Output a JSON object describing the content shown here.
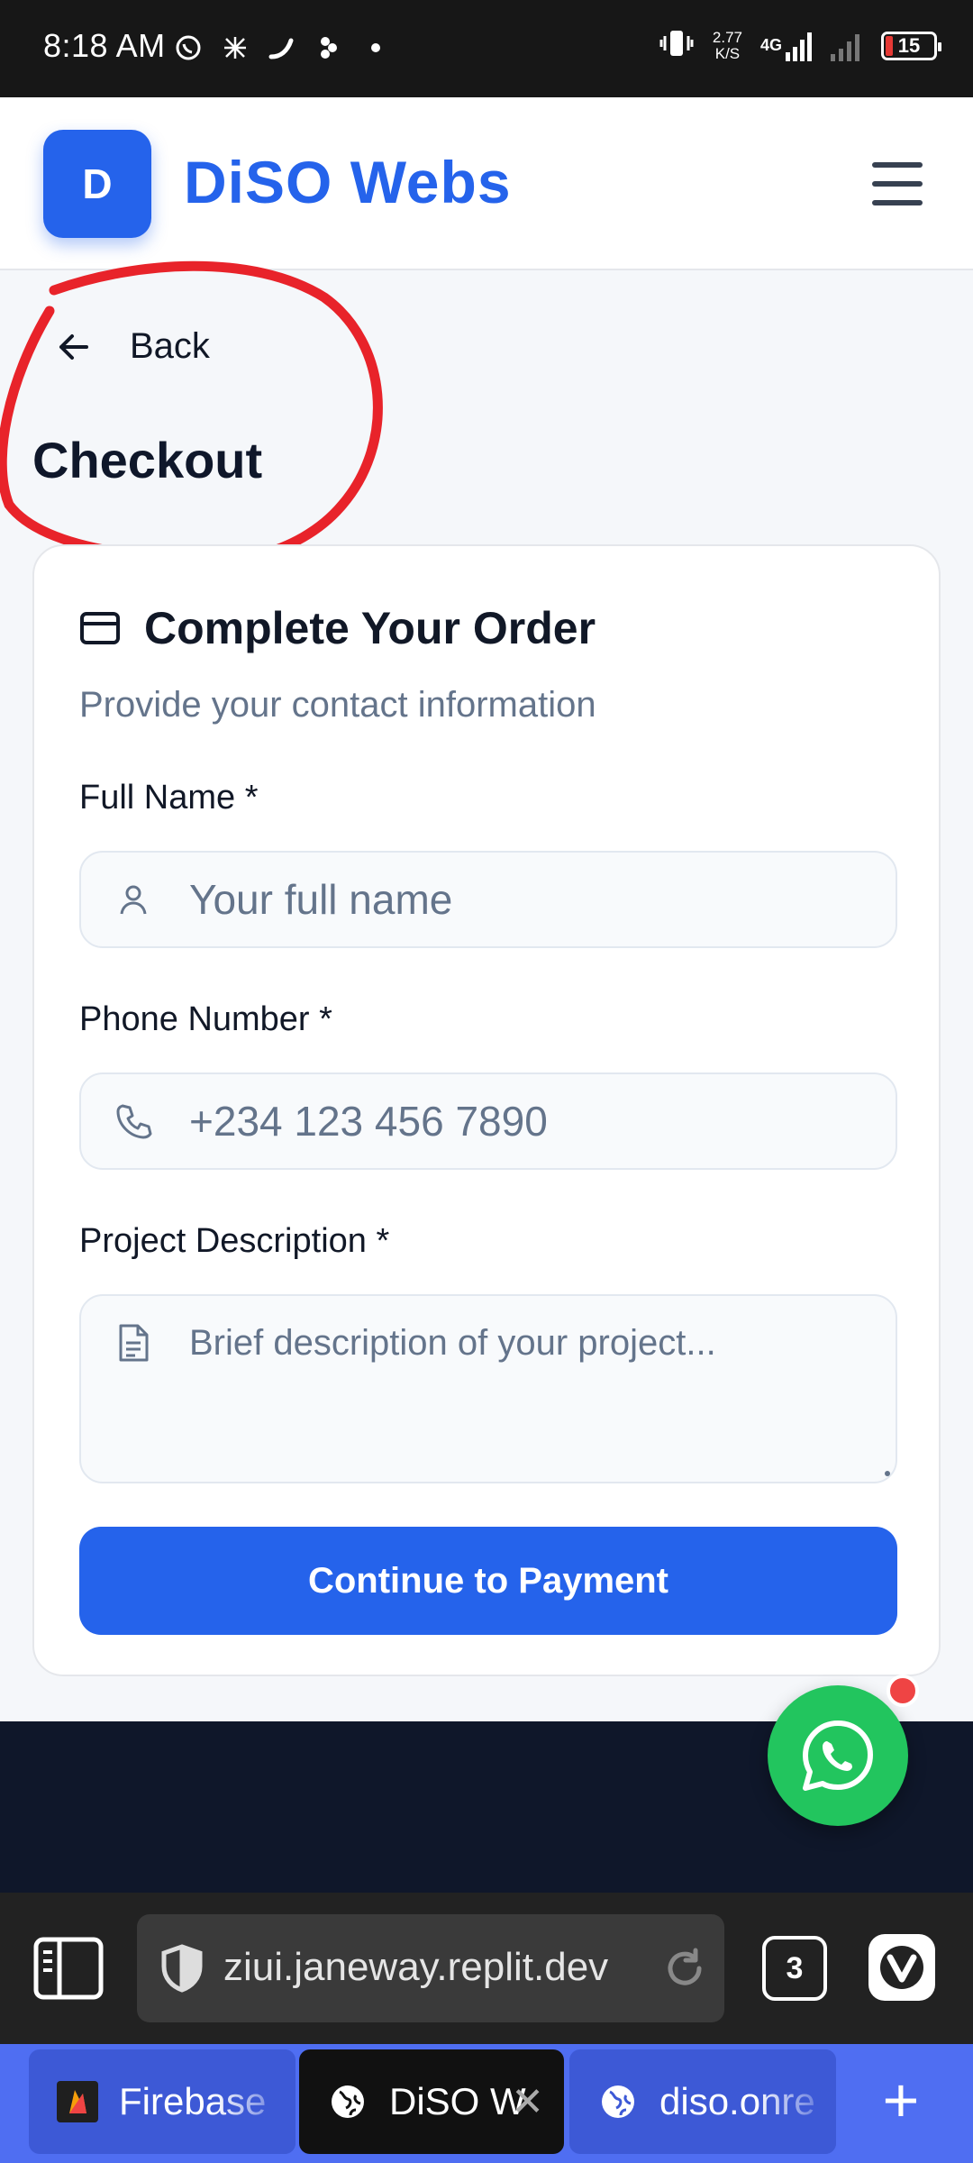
{
  "status_bar": {
    "time": "8:18 AM",
    "net_speed_value": "2.77",
    "net_speed_unit": "K/S",
    "network": "4G",
    "battery": "15"
  },
  "header": {
    "logo_letter": "D",
    "brand": "DiSO Webs"
  },
  "nav": {
    "back_label": "Back",
    "page_title": "Checkout"
  },
  "form": {
    "title": "Complete Your Order",
    "subtitle": "Provide your contact information",
    "full_name": {
      "label": "Full Name *",
      "placeholder": "Your full name"
    },
    "phone": {
      "label": "Phone Number *",
      "placeholder": "+234 123 456 7890"
    },
    "description": {
      "label": "Project Description *",
      "placeholder": "Brief description of your project..."
    },
    "submit_label": "Continue to Payment"
  },
  "browser": {
    "url": "ziui.janeway.replit.dev",
    "tab_count": "3",
    "tabs": [
      {
        "title": "Firebase"
      },
      {
        "title": "DiSO W"
      },
      {
        "title": "diso.onre"
      }
    ]
  },
  "colors": {
    "primary": "#2563eb",
    "whatsapp": "#22c55e",
    "annotation": "#e8232a"
  }
}
